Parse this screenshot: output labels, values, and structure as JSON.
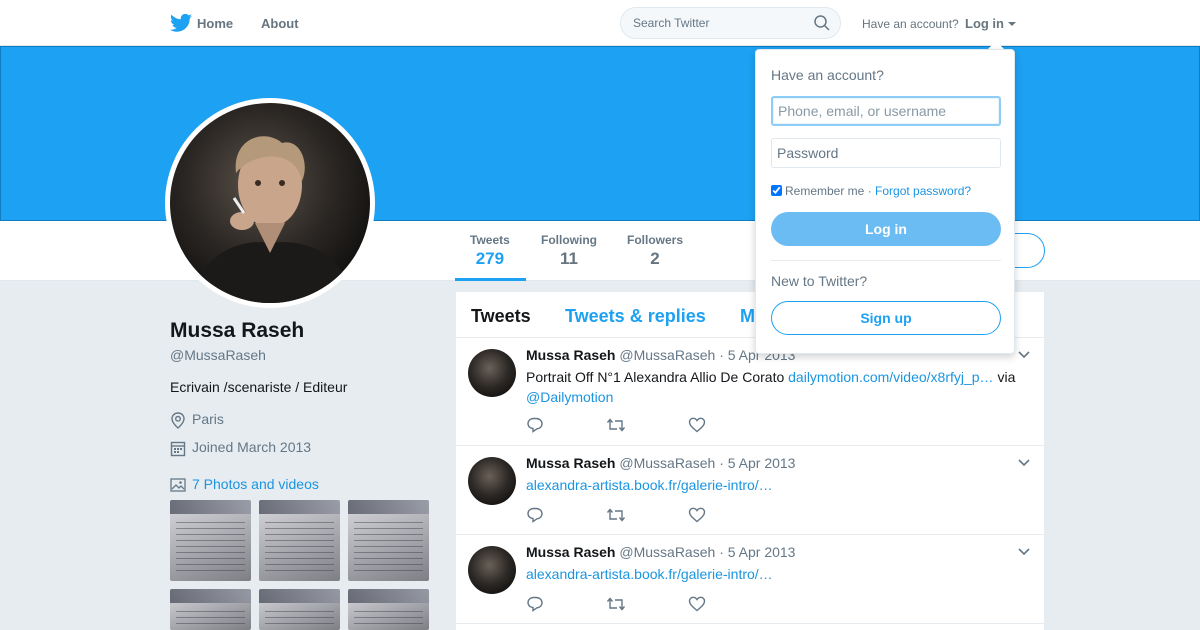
{
  "nav": {
    "home_label": "Home",
    "about_label": "About",
    "search_placeholder": "Search Twitter",
    "have_account": "Have an account?",
    "login_label": "Log in"
  },
  "profile": {
    "name": "Mussa Raseh",
    "handle": "@MussaRaseh",
    "bio": "Ecrivain /scenariste / Editeur",
    "location": "Paris",
    "joined": "Joined March 2013",
    "photos_label": "7 Photos and videos"
  },
  "stats": [
    {
      "label": "Tweets",
      "value": "279"
    },
    {
      "label": "Following",
      "value": "11"
    },
    {
      "label": "Followers",
      "value": "2"
    }
  ],
  "timeline": {
    "tabs": [
      "Tweets",
      "Tweets & replies",
      "M"
    ],
    "tweets": [
      {
        "name": "Mussa Raseh",
        "handle": "@MussaRaseh",
        "date": "· 5 Apr 2013",
        "text_before": "Portrait Off N°1 Alexandra Allio De Corato ",
        "link": "dailymotion.com/video/x8rfyj_p…",
        "text_after": " via ",
        "mention": "@Dailymotion"
      },
      {
        "name": "Mussa Raseh",
        "handle": "@MussaRaseh",
        "date": "· 5 Apr 2013",
        "link": "alexandra-artista.book.fr/galerie-intro/…"
      },
      {
        "name": "Mussa Raseh",
        "handle": "@MussaRaseh",
        "date": "· 5 Apr 2013",
        "link": "alexandra-artista.book.fr/galerie-intro/…"
      }
    ]
  },
  "login_dropdown": {
    "title": "Have an account?",
    "username_placeholder": "Phone, email, or username",
    "password_placeholder": "Password",
    "remember_label": "Remember me",
    "separator": " · ",
    "forgot_label": "Forgot password?",
    "login_button": "Log in",
    "new_label": "New to Twitter?",
    "signup_button": "Sign up"
  },
  "colors": {
    "brand": "#1da1f2",
    "banner": "#1da1f2",
    "link": "#1b95e0",
    "background": "#e6ecf0"
  },
  "icons": [
    "twitter-bird-icon",
    "search-icon",
    "location-icon",
    "calendar-icon",
    "photo-icon",
    "reply-icon",
    "retweet-icon",
    "like-icon",
    "chevron-down-icon"
  ]
}
